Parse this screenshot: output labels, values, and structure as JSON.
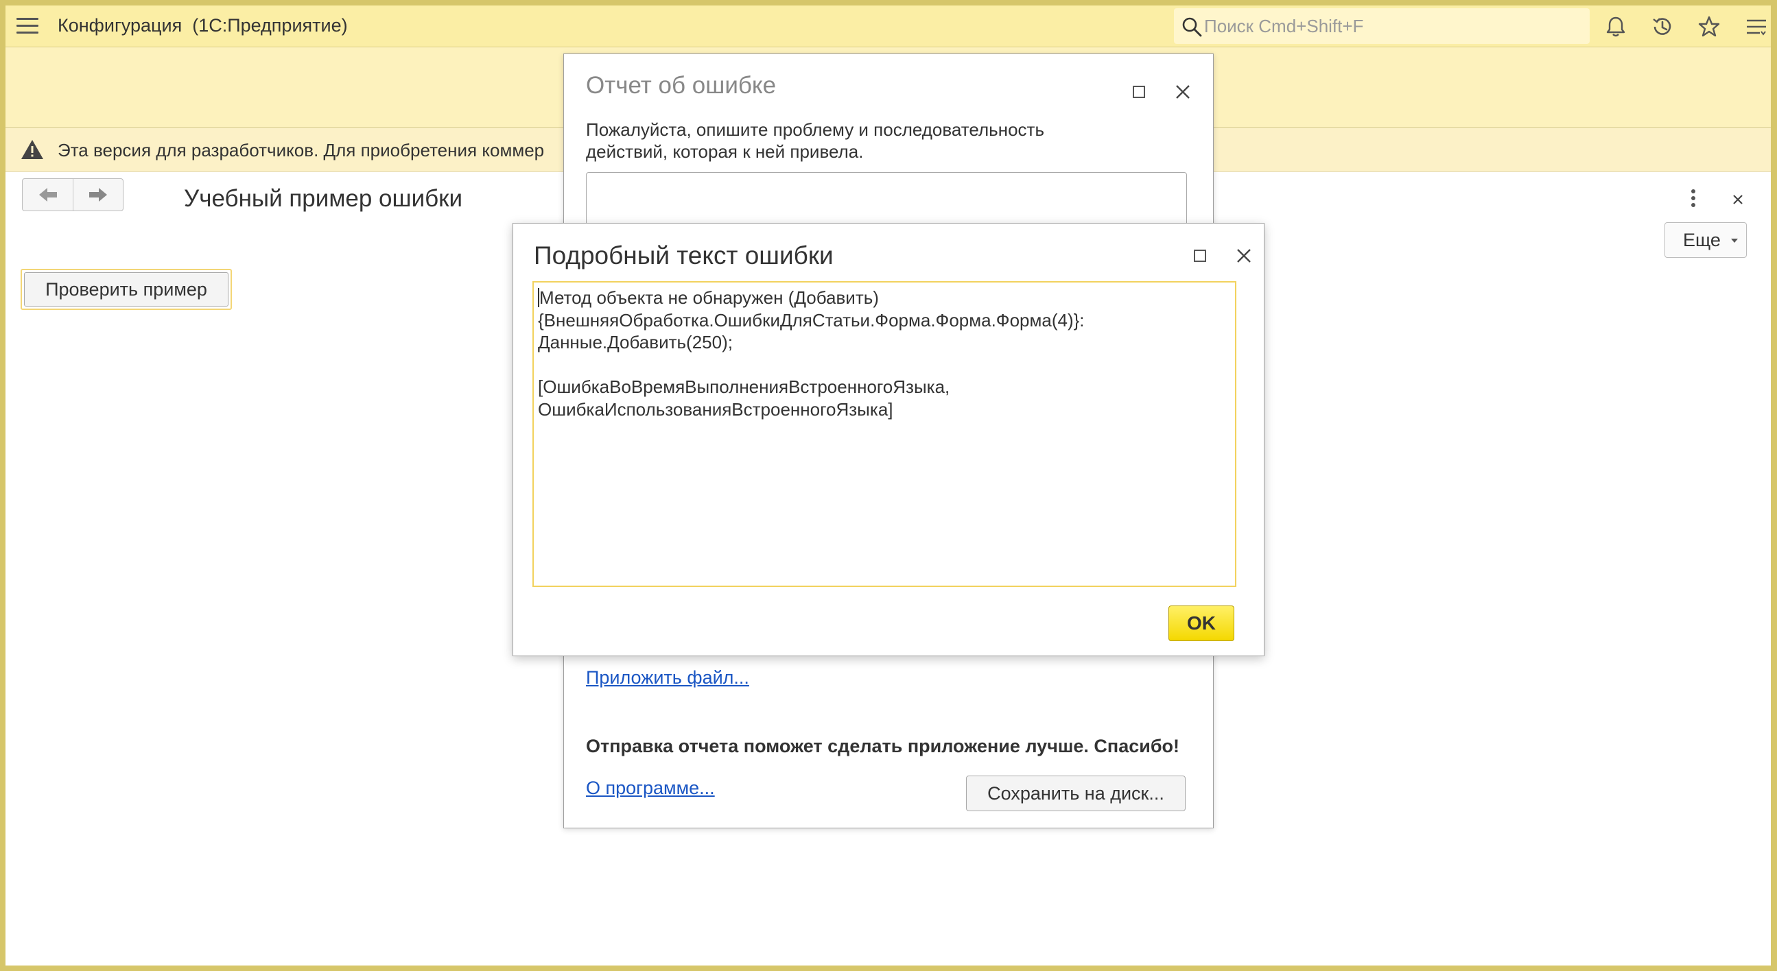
{
  "app": {
    "title": "Конфигурация  (1С:Предприятие)",
    "search_placeholder": "Поиск Cmd+Shift+F"
  },
  "warning": {
    "text": "Эта версия для разработчиков. Для приобретения коммер"
  },
  "form": {
    "title": "Учебный пример ошибки",
    "more_label": "Еще",
    "check_button": "Проверить пример"
  },
  "report_dialog": {
    "title": "Отчет об ошибке",
    "description_line1": "Пожалуйста, опишите проблему и последовательность",
    "description_line2": "действий, которая к ней привела.",
    "attach_link": "Приложить файл...",
    "thanks_text": "Отправка отчета поможет сделать приложение лучше. Спасибо!",
    "about_link": "О программе...",
    "save_button": "Сохранить на диск..."
  },
  "detail_dialog": {
    "title": "Подробный текст ошибки",
    "lines": [
      "Метод объекта не обнаружен (Добавить)",
      "{ВнешняяОбработка.ОшибкиДляСтатьи.Форма.Форма.Форма(4)}:",
      "Данные.Добавить(250);",
      "",
      "[ОшибкаВоВремяВыполненияВстроенногоЯзыка,",
      "ОшибкаИспользованияВстроенногоЯзыка]"
    ],
    "ok_button": "OK"
  },
  "colors": {
    "topbar": "#fbeea5",
    "warning_band": "#fcf1c7",
    "link": "#1a56c4",
    "ok_button": "#f4d800",
    "frame": "#d6c66a"
  }
}
